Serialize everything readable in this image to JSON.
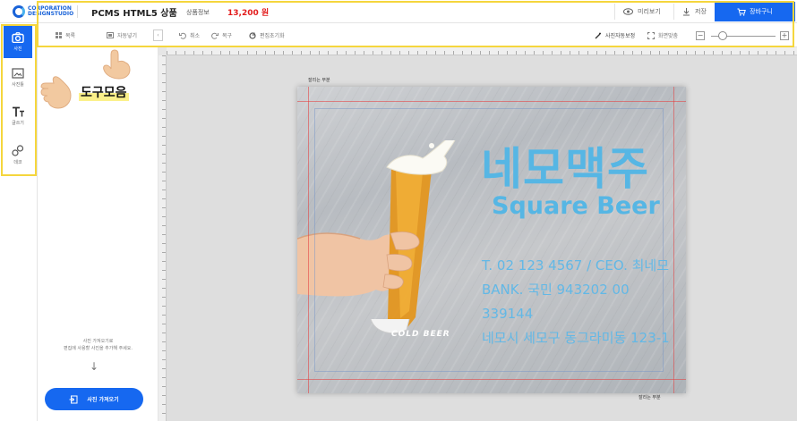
{
  "header": {
    "logo_line1": "CORPORATION",
    "logo_line2": "DESIGNSTUDIO",
    "product_title": "PCMS HTML5 상품",
    "product_info": "상품정보",
    "price": "13,200 원",
    "preview_label": "미리보기",
    "save_label": "저장",
    "cart_label": "장바구니"
  },
  "toolbar": {
    "list": "목록",
    "auto_add": "자동넣기",
    "undo": "취소",
    "redo": "복구",
    "reset": "편집초기화",
    "photo_autofit": "사진자동보정",
    "fullscreen": "화면맞춤"
  },
  "sidebar": {
    "items": [
      {
        "label": "사진",
        "icon": "camera-icon"
      },
      {
        "label": "사진틀",
        "icon": "frame-icon"
      },
      {
        "label": "글쓰기",
        "icon": "text-icon"
      },
      {
        "label": "데코"
      }
    ]
  },
  "panel": {
    "tool_label": "도구모음",
    "hint_line1": "사진 가져오기로",
    "hint_line2": "편집에 사용할 사진을 추가해 주세요.",
    "upload_label": "사진 가져오기"
  },
  "canvas": {
    "cut_label_top": "잘리는 부분",
    "cut_label_bottom": "잘리는 부분",
    "title": "네모맥주",
    "subtitle": "Square Beer",
    "phone_line": "T. 02 123 4567  /  CEO. 최네모",
    "bank_line": "BANK. 국민 943202 00 339144",
    "address_line": "네모시 세모구 동그라미동 123-1",
    "glass_text": "COLD BEER"
  },
  "colors": {
    "accent": "#1668f0",
    "price": "#e21b1b",
    "highlight": "#f5d63d",
    "brand_text": "#56b6e4"
  }
}
